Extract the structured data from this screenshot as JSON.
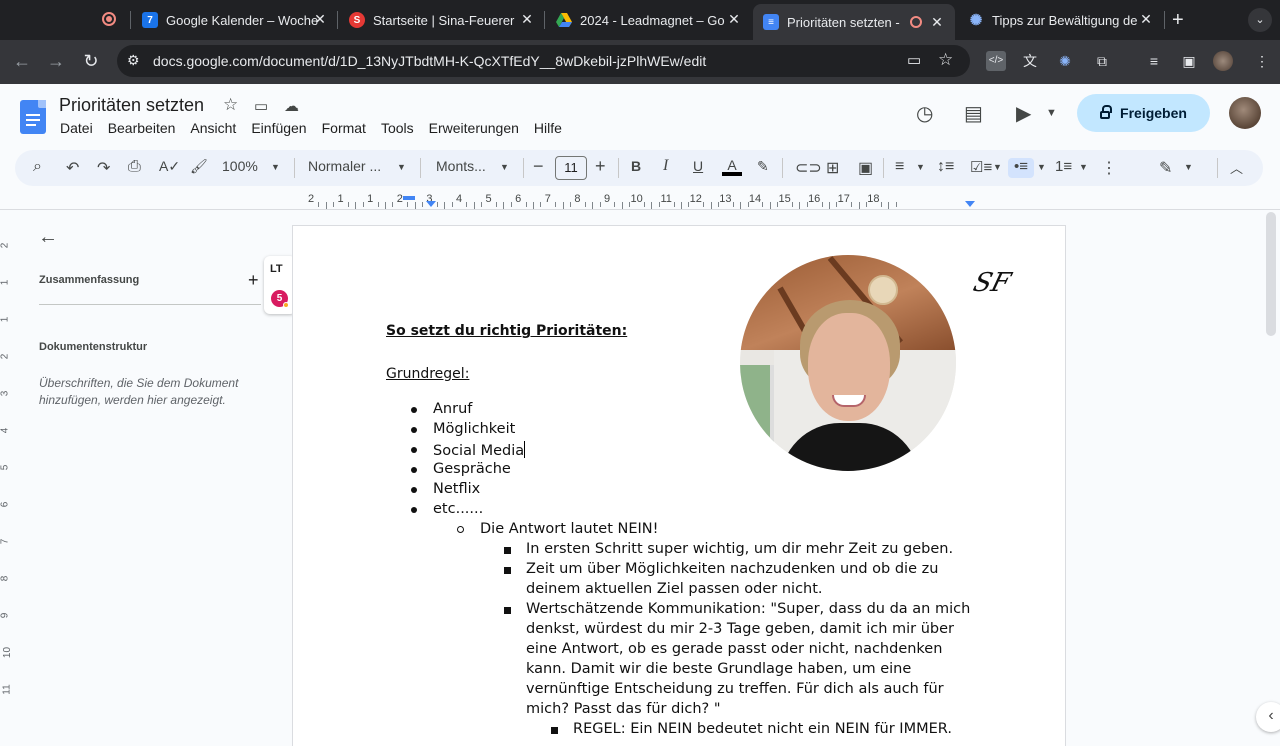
{
  "browser": {
    "tabs": [
      {
        "title": "",
        "icon": "recording-icon"
      },
      {
        "title": "Google Kalender – Woche",
        "icon": "calendar-icon",
        "icon_label": "7"
      },
      {
        "title": "Startseite | Sina-Feuerer",
        "icon": "site-icon"
      },
      {
        "title": "2024 - Leadmagnet – Go",
        "icon": "drive-icon"
      },
      {
        "title": "Prioritäten setzten - ",
        "icon": "docs-icon",
        "active": true
      },
      {
        "title": "Tipps zur Bewältigung de",
        "icon": "sparkle-icon"
      }
    ],
    "new_tab": "+",
    "url": "docs.google.com/document/d/1D_13NyJTbdtMH-K-QcXTfEdY__8wDkebil-jzPlhWEw/edit"
  },
  "doc_header": {
    "title": "Prioritäten setzten",
    "menu": [
      "Datei",
      "Bearbeiten",
      "Ansicht",
      "Einfügen",
      "Format",
      "Tools",
      "Erweiterungen",
      "Hilfe"
    ],
    "share_label": "Freigeben"
  },
  "format_toolbar": {
    "zoom": "100%",
    "style": "Normaler ...",
    "font": "Monts...",
    "font_size": "11"
  },
  "ruler": {
    "labels": [
      "2",
      "1",
      "1",
      "2",
      "3",
      "4",
      "5",
      "6",
      "7",
      "8",
      "9",
      "10",
      "11",
      "12",
      "13",
      "14",
      "15",
      "16",
      "17",
      "18"
    ],
    "vertical_labels": [
      "2",
      "1",
      "1",
      "2",
      "3",
      "4",
      "5",
      "6",
      "7",
      "8",
      "9",
      "10",
      "11"
    ]
  },
  "sidebar": {
    "summary_heading": "Zusammenfassung",
    "outline_heading": "Dokumentenstruktur",
    "outline_hint": "Überschriften, die Sie dem Dokument hinzufügen, werden hier angezeigt.",
    "lt_label": "LT",
    "lt_count": "5"
  },
  "document": {
    "heading": "So setzt du richtig Prioritäten:",
    "subheading": "Grundregel:",
    "bullets": [
      "Anruf",
      "Möglichkeit",
      "Social Media",
      "Gespräche",
      "Netflix",
      "etc......"
    ],
    "level2": "Die Antwort lautet NEIN!",
    "level3": [
      "In ersten Schritt super wichtig, um dir mehr Zeit zu geben.",
      "Zeit um über Möglichkeiten nachzudenken und ob die zu",
      "deinem aktuellen Ziel passen oder nicht.",
      "Wertschätzende Kommunikation: \"Super, dass du da an mich",
      "denkst, würdest du mir 2-3 Tage geben, damit ich mir über",
      "eine Antwort, ob es gerade passt oder nicht, nachdenken",
      "kann. Damit wir die beste Grundlage haben, um eine",
      "vernünftige Entscheidung zu treffen. Für dich als auch für",
      "mich? Passt das für dich? \""
    ],
    "level4": "REGEL: Ein NEIN bedeutet nicht ein NEIN für IMMER.",
    "logo_text": "SF"
  }
}
